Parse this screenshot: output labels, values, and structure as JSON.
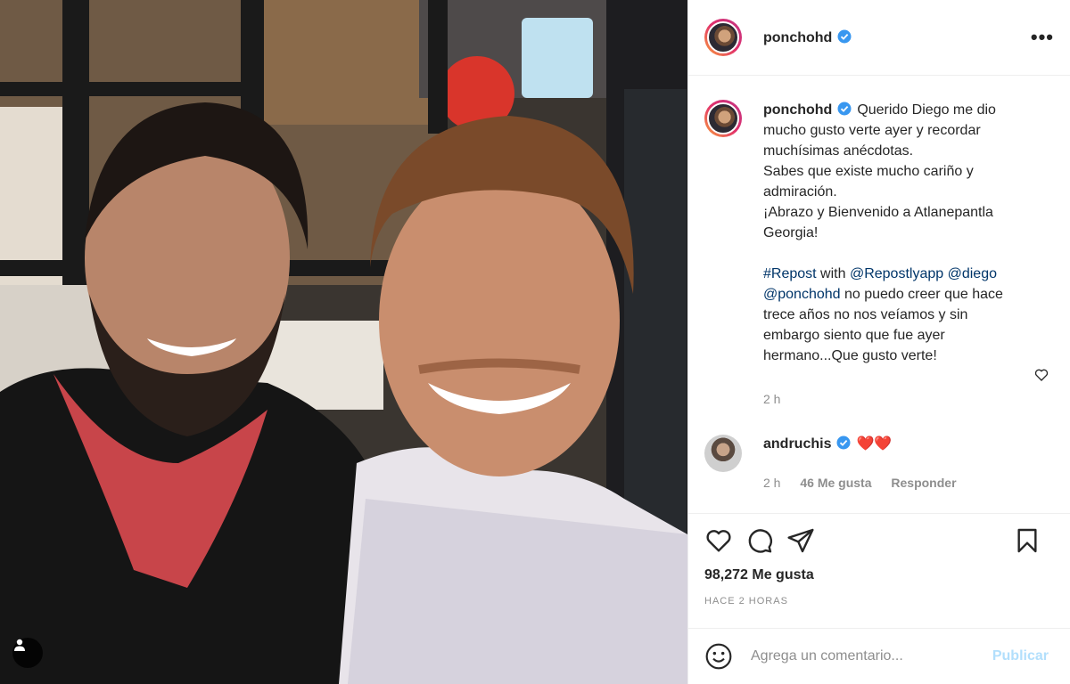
{
  "header": {
    "username": "ponchohd",
    "more_label": "•••"
  },
  "caption": {
    "username": "ponchohd",
    "lines": [
      "Querido Diego me dio mucho gusto verte ayer y recordar muchísimas anécdotas.",
      "Sabes que existe mucho cariño y admiración.",
      "¡Abrazo y Bienvenido a Atlanepantla Georgia!"
    ],
    "repost_hashtag": "#Repost",
    "repost_with": "with",
    "mention_app": "@Repostlyapp",
    "mention_diego": "@diego",
    "mention_poncho": "@ponchohd",
    "repost_text": "no puedo creer que hace trece años no nos veíamos y sin embargo siento que fue ayer hermano...Que gusto verte!",
    "time": "2 h"
  },
  "comment": {
    "username": "andruchis",
    "text": "❤️❤️",
    "time": "2 h",
    "likes": "46 Me gusta",
    "reply": "Responder"
  },
  "footer": {
    "likes": "98,272 Me gusta",
    "time_ago": "HACE 2 HORAS",
    "comment_placeholder": "Agrega un comentario...",
    "publish_label": "Publicar"
  },
  "colors": {
    "verified_blue": "#3897f0",
    "link": "#003569",
    "muted": "#8e8e8e",
    "publish_disabled": "#b2dffc",
    "heart_red": "#ed1c24"
  },
  "icons": [
    "user-tag-icon",
    "verified-icon",
    "more-icon",
    "heart-icon",
    "comment-icon",
    "share-icon",
    "save-icon",
    "emoji-icon",
    "small-heart-icon"
  ]
}
